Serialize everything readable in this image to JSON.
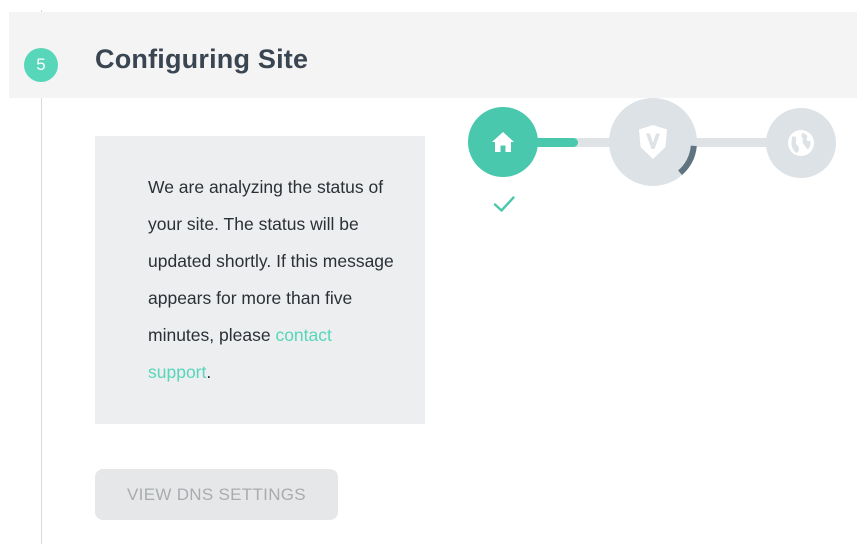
{
  "step": {
    "number": "5",
    "title": "Configuring Site",
    "accent_color": "#57d6ba"
  },
  "info": {
    "message": "We are analyzing the status of your site. The status will be updated shortly. If this message appears for more than five minutes, please",
    "link_label": "contact support",
    "trailing": "."
  },
  "actions": {
    "view_dns_label": "VIEW DNS SETTINGS",
    "view_dns_disabled": true
  },
  "progress": {
    "stages": [
      {
        "icon": "home-icon",
        "state": "complete"
      },
      {
        "icon": "shield-icon",
        "state": "in-progress",
        "progress": 0.12
      },
      {
        "icon": "globe-icon",
        "state": "pending"
      }
    ],
    "first_connector_fill": 0.55
  }
}
